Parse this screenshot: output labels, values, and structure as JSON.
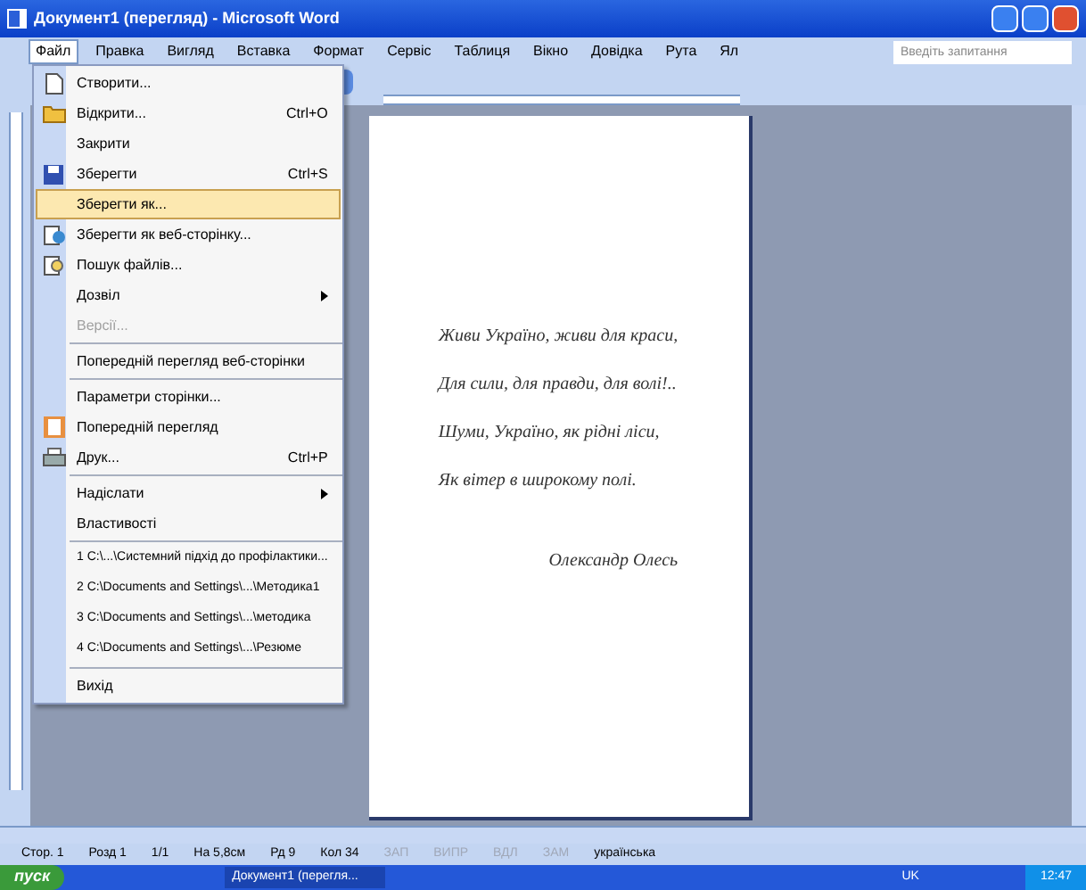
{
  "window": {
    "title": "Документ1 (перегляд) - Microsoft Word"
  },
  "menubar": [
    {
      "label": "Файл",
      "selected": true
    },
    {
      "label": "Правка",
      "selected": false
    },
    {
      "label": "Вигляд",
      "selected": false
    },
    {
      "label": "Вставка",
      "selected": false
    },
    {
      "label": "Формат",
      "selected": false
    },
    {
      "label": "Сервіс",
      "selected": false
    },
    {
      "label": "Таблиця",
      "selected": false
    },
    {
      "label": "Вікно",
      "selected": false
    },
    {
      "label": "Довідка",
      "selected": false
    },
    {
      "label": "Рута",
      "selected": false
    },
    {
      "label": "Ял",
      "selected": false
    }
  ],
  "help_search": {
    "placeholder": "Введіть запитання"
  },
  "file_menu": [
    {
      "label": "Створити...",
      "kind": "item",
      "selected": false,
      "disabled": false
    },
    {
      "label": "Відкрити...",
      "shortcut": "Ctrl+O",
      "kind": "item",
      "selected": false,
      "disabled": false
    },
    {
      "label": "Закрити",
      "kind": "item",
      "selected": false,
      "disabled": false
    },
    {
      "label": "Зберегти",
      "shortcut": "Ctrl+S",
      "kind": "item",
      "selected": false,
      "disabled": false
    },
    {
      "label": "Зберегти як...",
      "kind": "item",
      "selected": true,
      "disabled": false
    },
    {
      "label": "Зберегти як веб-сторінку...",
      "kind": "item",
      "selected": false,
      "disabled": false
    },
    {
      "label": "Пошук файлів...",
      "kind": "item",
      "selected": false,
      "disabled": false
    },
    {
      "label": "Дозвіл",
      "kind": "submenu",
      "selected": false,
      "disabled": false
    },
    {
      "label": "Версії...",
      "kind": "item",
      "selected": false,
      "disabled": true
    },
    {
      "label": "Попередній перегляд веб-сторінки",
      "kind": "item",
      "selected": false,
      "disabled": false,
      "separator_before": true
    },
    {
      "label": "Параметри сторінки...",
      "kind": "item",
      "selected": false,
      "disabled": false,
      "separator_before": true
    },
    {
      "label": "Попередній перегляд",
      "kind": "item",
      "selected": false,
      "disabled": false
    },
    {
      "label": "Друк...",
      "shortcut": "Ctrl+P",
      "kind": "item",
      "selected": false,
      "disabled": false
    },
    {
      "label": "Надіслати",
      "kind": "submenu",
      "selected": false,
      "disabled": false,
      "separator_before": true
    },
    {
      "label": "Властивості",
      "kind": "item",
      "selected": false,
      "disabled": false
    },
    {
      "label": "1 C:\\...\\Системний підхід до профілактики...",
      "kind": "item",
      "selected": false,
      "disabled": false,
      "separator_before": true
    },
    {
      "label": "2 C:\\Documents and Settings\\...\\Методика1",
      "kind": "item",
      "selected": false,
      "disabled": false
    },
    {
      "label": "3 C:\\Documents and Settings\\...\\методика",
      "kind": "item",
      "selected": false,
      "disabled": false
    },
    {
      "label": "4 C:\\Documents and Settings\\...\\Резюме",
      "kind": "item",
      "selected": false,
      "disabled": false
    },
    {
      "label": "Вихід",
      "kind": "item",
      "selected": false,
      "disabled": false,
      "separator_before": true
    }
  ],
  "document": {
    "lines": [
      "Живи Україно, живи для краси,",
      "Для сили, для правди, для волі!..",
      "Шуми, Україно, як рідні ліси,",
      "Як вітер в широкому полі."
    ],
    "author": "Олександр Олесь"
  },
  "status_bar": [
    {
      "text": "Стор. 1",
      "disabled": false
    },
    {
      "text": "Розд 1",
      "disabled": false
    },
    {
      "text": "1/1",
      "disabled": false
    },
    {
      "text": "На 5,8см",
      "disabled": false
    },
    {
      "text": "Рд 9",
      "disabled": false
    },
    {
      "text": "Кол 34",
      "disabled": false
    },
    {
      "text": "ЗАП",
      "disabled": true
    },
    {
      "text": "ВИПР",
      "disabled": true
    },
    {
      "text": "ВДЛ",
      "disabled": true
    },
    {
      "text": "ЗАМ",
      "disabled": true
    },
    {
      "text": "українська",
      "disabled": false
    }
  ],
  "taskbar": {
    "start": "пуск",
    "tasks": [
      {
        "label": "Документ1 (перегля...",
        "selected": true
      }
    ],
    "language": "UK",
    "clock": "12:47"
  }
}
